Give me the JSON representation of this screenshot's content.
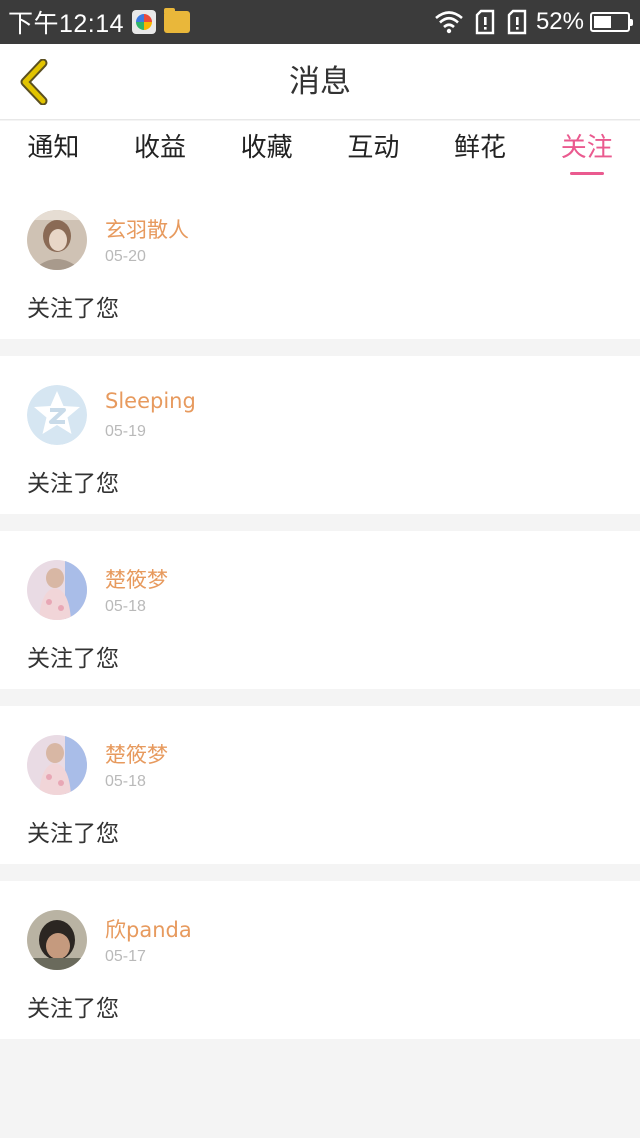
{
  "status_bar": {
    "time": "下午12:14",
    "battery_percent": "52%",
    "battery_level": 0.52,
    "icons": [
      "app-icon",
      "folder-icon",
      "wifi-icon",
      "sim-card-icon",
      "sim-card-icon",
      "battery-icon"
    ]
  },
  "header": {
    "title": "消息",
    "back_icon": "chevron-left-icon",
    "back_icon_color": "#e2c400"
  },
  "tabs": [
    {
      "label": "通知",
      "active": false
    },
    {
      "label": "收益",
      "active": false
    },
    {
      "label": "收藏",
      "active": false
    },
    {
      "label": "互动",
      "active": false
    },
    {
      "label": "鲜花",
      "active": false
    },
    {
      "label": "关注",
      "active": true
    }
  ],
  "colors": {
    "accent": "#ea5a8f",
    "username": "#e79a5e",
    "date": "#b9b9b9"
  },
  "notifications": [
    {
      "username": "玄羽散人",
      "date": "05-20",
      "message": "关注了您",
      "avatar": "photo-avatar"
    },
    {
      "username": "Sleeping",
      "date": "05-19",
      "message": "关注了您",
      "avatar": "qq-default-avatar"
    },
    {
      "username": "楚筱梦",
      "date": "05-18",
      "message": "关注了您",
      "avatar": "photo-avatar"
    },
    {
      "username": "楚筱梦",
      "date": "05-18",
      "message": "关注了您",
      "avatar": "photo-avatar"
    },
    {
      "username": "欣panda",
      "date": "05-17",
      "message": "关注了您",
      "avatar": "photo-avatar"
    }
  ]
}
